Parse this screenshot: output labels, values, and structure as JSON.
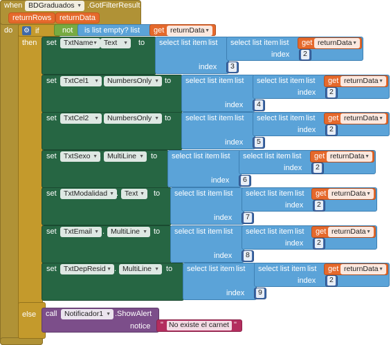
{
  "event": {
    "when": "when",
    "component": "BDGraduados",
    "method": ".GotFilterResult",
    "params": [
      "returnRows",
      "returnData"
    ],
    "do": "do"
  },
  "if_block": {
    "if": "if",
    "then": "then",
    "else": "else",
    "not": "not",
    "is_list_empty": "is list empty?  list",
    "get": "get",
    "var": "returnData"
  },
  "common": {
    "set": "set",
    "to": "to",
    "select_list_item": "select list item",
    "list": "list",
    "index": "index",
    "get": "get",
    "var": "returnData",
    "inner_index": "2"
  },
  "rows": [
    {
      "component": "TxtName",
      "property": "Text",
      "outer_index": "3"
    },
    {
      "component": "TxtCel1",
      "property": "NumbersOnly",
      "outer_index": "4"
    },
    {
      "component": "TxtCel2",
      "property": "NumbersOnly",
      "outer_index": "5"
    },
    {
      "component": "TxtSexo",
      "property": "MultiLine",
      "outer_index": "6"
    },
    {
      "component": "TxtModalidad",
      "property": "Text",
      "outer_index": "7"
    },
    {
      "component": "TxtEmail",
      "property": "MultiLine",
      "outer_index": "8"
    },
    {
      "component": "TxtDepResid",
      "property": "MultiLine",
      "outer_index": "9"
    }
  ],
  "call": {
    "call": "call",
    "component": "Notificador1",
    "method": ".ShowAlert",
    "notice": "notice",
    "text": "No existe el carnet",
    "quote": "\""
  },
  "colors": {
    "event": "#B09236",
    "set": "#266643",
    "list": "#5BA3D8",
    "number": "#3F69A8",
    "get": "#E5692C",
    "logic": "#77AB41",
    "call": "#7C4E8A",
    "text": "#B32D5E"
  }
}
